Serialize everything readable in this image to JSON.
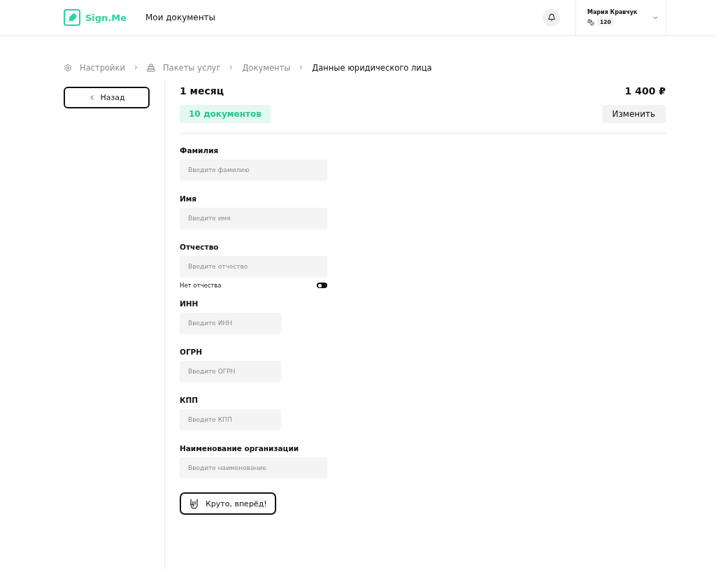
{
  "header": {
    "logo": "Sign.Me",
    "nav": "Мои документы",
    "user": {
      "name": "Мария Кравчук",
      "balance": "120"
    }
  },
  "breadcrumbs": [
    {
      "label": "Настройки",
      "current": false
    },
    {
      "label": "Пакеты услуг",
      "current": false
    },
    {
      "label": "Документы",
      "current": false
    },
    {
      "label": "Данные юридического лица",
      "current": true
    }
  ],
  "back_button": "Назад",
  "plan": {
    "title": "1 месяц",
    "price": "1 400 ₽",
    "documents": "10 документов",
    "change_button": "Изменить"
  },
  "fields": [
    {
      "label": "Фамилия",
      "placeholder": "Введите фамилию",
      "kind": "wide"
    },
    {
      "label": "Имя",
      "placeholder": "Введите имя",
      "kind": "wide"
    },
    {
      "label": "Отчество",
      "placeholder": "Введите отчество",
      "kind": "wide",
      "toggle": {
        "label": "Нет отчества",
        "on": false
      }
    },
    {
      "label": "ИНН",
      "placeholder": "Введите ИНН",
      "kind": "narrow"
    },
    {
      "label": "ОГРН",
      "placeholder": "Введите ОГРН",
      "kind": "narrow"
    },
    {
      "label": "КПП",
      "placeholder": "Введите КПП",
      "kind": "narrow"
    },
    {
      "label": "Наименование организации",
      "placeholder": "Введите наименование",
      "kind": "wide"
    }
  ],
  "submit_button": "Круто, вперёд!"
}
